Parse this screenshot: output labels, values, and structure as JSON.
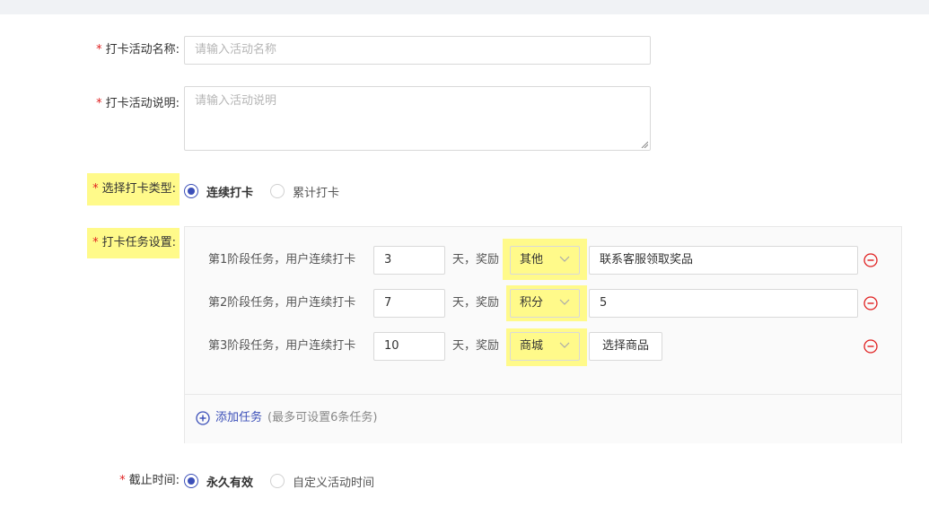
{
  "form": {
    "name": {
      "label": "打卡活动名称:",
      "placeholder": "请输入活动名称"
    },
    "desc": {
      "label": "打卡活动说明:",
      "placeholder": "请输入活动说明"
    },
    "type": {
      "label": "选择打卡类型:",
      "options": [
        "连续打卡",
        "累计打卡"
      ],
      "selected": "连续打卡"
    },
    "tasks": {
      "label": "打卡任务设置:",
      "stages": [
        {
          "prefix": "第1阶段任务，用户连续打卡",
          "days": "3",
          "mid": "天，奖励",
          "reward_type": "其他",
          "reward_value": "联系客服领取奖品"
        },
        {
          "prefix": "第2阶段任务，用户连续打卡",
          "days": "7",
          "mid": "天，奖励",
          "reward_type": "积分",
          "reward_value": "5"
        },
        {
          "prefix": "第3阶段任务，用户连续打卡",
          "days": "10",
          "mid": "天，奖励",
          "reward_type": "商城",
          "reward_button": "选择商品"
        }
      ],
      "add_label": "添加任务",
      "add_hint": "(最多可设置6条任务)"
    },
    "deadline": {
      "label": "截止时间:",
      "options": [
        "永久有效",
        "自定义活动时间"
      ],
      "selected": "永久有效"
    }
  },
  "required_mark": "*",
  "colors": {
    "accent": "#3b4fb8",
    "required": "#e02020",
    "highlight": "#fffa8a",
    "remove": "#e02020"
  },
  "icons": {
    "select_arrow": "chevron-down-icon",
    "remove": "minus-circle-icon",
    "add": "plus-circle-icon"
  }
}
